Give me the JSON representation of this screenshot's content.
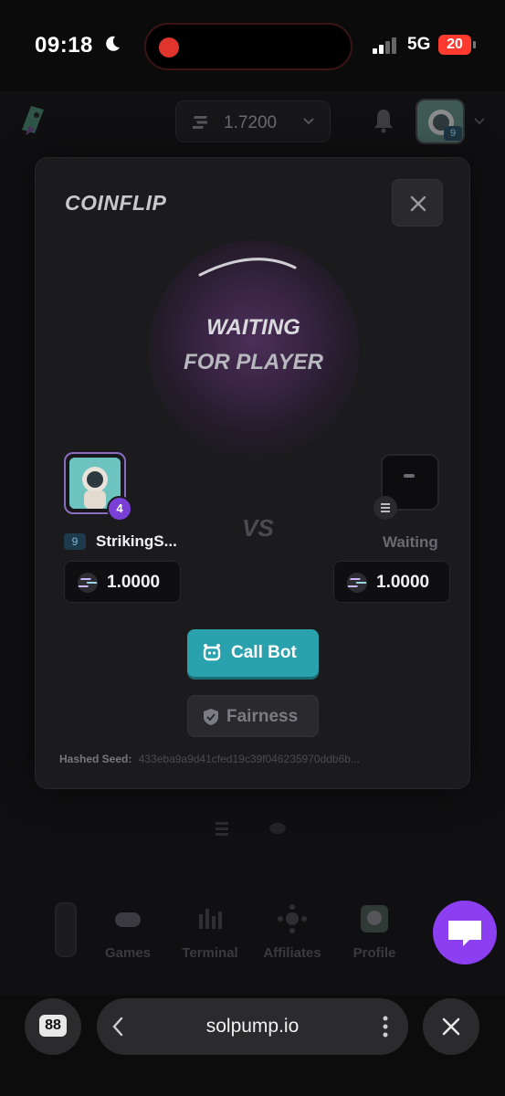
{
  "status_bar": {
    "time": "09:18",
    "network": "5G",
    "battery": "20"
  },
  "app": {
    "balance": "1.7200",
    "header_level": "9",
    "bottom_nav": [
      {
        "label": "Games",
        "icon": "gamepad-icon"
      },
      {
        "label": "Terminal",
        "icon": "chart-icon"
      },
      {
        "label": "Affiliates",
        "icon": "network-icon"
      },
      {
        "label": "Profile",
        "icon": "avatar-icon"
      }
    ]
  },
  "modal": {
    "title": "COINFLIP",
    "waiting_line1": "WAITING",
    "waiting_line2": "FOR PLAYER",
    "player1": {
      "name": "StrikingS...",
      "level": "9",
      "badge": "4",
      "bet": "1.0000"
    },
    "player2": {
      "status": "Waiting",
      "bet": "1.0000"
    },
    "call_bot_label": "Call Bot",
    "fairness_label": "Fairness",
    "seed_label": "Hashed Seed:",
    "seed_value": "433eba9a9d41cfed19c39f046235970ddb6b..."
  },
  "browser": {
    "tabs_count": "88",
    "url": "solpump.io"
  },
  "colors": {
    "accent_teal": "#2aa2ae",
    "accent_purple": "#8b3ff0",
    "record_red": "#e0342c",
    "battery_red": "#ff3b30"
  }
}
